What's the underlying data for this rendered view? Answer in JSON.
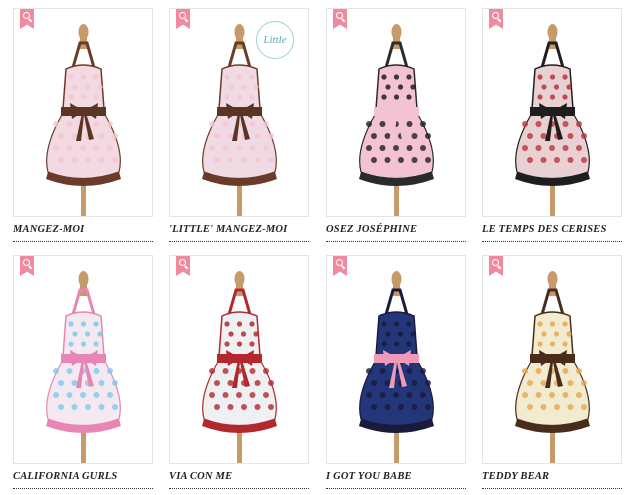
{
  "badge_text": "Little",
  "products": [
    {
      "name": "MANGEZ-MOI",
      "fabric": "#f2d9e2",
      "accent": "#6a3b28",
      "sash": "#5a3524",
      "trim": "#f5c6d4",
      "icon": "zoom-icon"
    },
    {
      "name": "'LITTLE' MANGEZ-MOI",
      "fabric": "#f0dbe4",
      "accent": "#6a3b28",
      "sash": "#5a3524",
      "trim": "#f5c6d4",
      "icon": "zoom-icon"
    },
    {
      "name": "OSEZ JOSÉPHINE",
      "fabric": "#f3c3d3",
      "accent": "#2b2b2b",
      "sash": "#f3c3d3",
      "trim": "#1f1f1f",
      "icon": "zoom-icon"
    },
    {
      "name": "LE TEMPS DES CERISES",
      "fabric": "#e9d0d2",
      "accent": "#1e1e1e",
      "sash": "#1e1e1e",
      "trim": "#b9343c",
      "icon": "zoom-icon"
    },
    {
      "name": "CALIFORNIA GURLS",
      "fabric": "#f5e9f1",
      "accent": "#e785b4",
      "sash": "#e785b4",
      "trim": "#7fc9ec",
      "icon": "zoom-icon"
    },
    {
      "name": "VIA CON ME",
      "fabric": "#eef0f2",
      "accent": "#b3282d",
      "sash": "#b3282d",
      "trim": "#b3282d",
      "icon": "zoom-icon"
    },
    {
      "name": "I GOT YOU BABE",
      "fabric": "#24367a",
      "accent": "#1a1a3a",
      "sash": "#f09ab9",
      "trim": "#1a1a3a",
      "icon": "zoom-icon"
    },
    {
      "name": "TEDDY BEAR",
      "fabric": "#f1ecd0",
      "accent": "#4a2c1c",
      "sash": "#4a2c1c",
      "trim": "#e9a74a",
      "icon": "zoom-icon"
    }
  ]
}
